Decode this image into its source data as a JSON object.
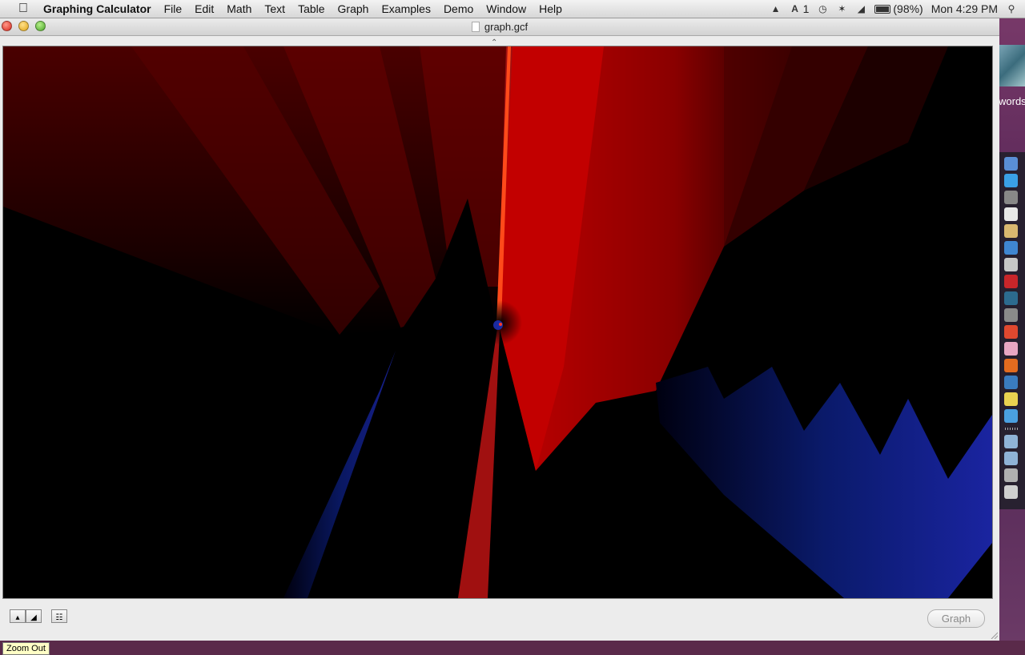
{
  "menubar": {
    "app_name": "Graphing Calculator",
    "menus": [
      "File",
      "Edit",
      "Math",
      "Text",
      "Table",
      "Graph",
      "Examples",
      "Demo",
      "Window",
      "Help"
    ],
    "status": {
      "notification_count": "1",
      "battery": "(98%)",
      "battery_level": 0.98,
      "clock": "Mon 4:29 PM"
    }
  },
  "window": {
    "title": "graph.gcf"
  },
  "bottombar": {
    "graph_button": "Graph",
    "tooltip": "Zoom Out"
  },
  "desktop": {
    "label": "words"
  },
  "dock": {
    "items": [
      {
        "name": "finder",
        "color": "#5a8fd6"
      },
      {
        "name": "app-store",
        "color": "#3aa0e6"
      },
      {
        "name": "launchpad",
        "color": "#888888"
      },
      {
        "name": "calendar",
        "color": "#e8e8e8"
      },
      {
        "name": "notes",
        "color": "#d9b870"
      },
      {
        "name": "itunes",
        "color": "#3f86d1"
      },
      {
        "name": "preview",
        "color": "#c7c7c7"
      },
      {
        "name": "photo-booth",
        "color": "#c8262a"
      },
      {
        "name": "time-machine",
        "color": "#2c6b8f"
      },
      {
        "name": "system-preferences",
        "color": "#8a8a8a"
      },
      {
        "name": "chrome",
        "color": "#e0482f"
      },
      {
        "name": "photos",
        "color": "#e8a6c2"
      },
      {
        "name": "firefox",
        "color": "#e36b1f"
      },
      {
        "name": "browser",
        "color": "#3a7cc0"
      },
      {
        "name": "colorsync",
        "color": "#e9d250"
      },
      {
        "name": "safari",
        "color": "#4aa0e0"
      },
      {
        "name": "applications-folder",
        "color": "#8fb3d6"
      },
      {
        "name": "documents-folder",
        "color": "#8fb3d6"
      },
      {
        "name": "downloads",
        "color": "#b0b0b0"
      },
      {
        "name": "trash",
        "color": "#cfcfcf"
      }
    ]
  }
}
